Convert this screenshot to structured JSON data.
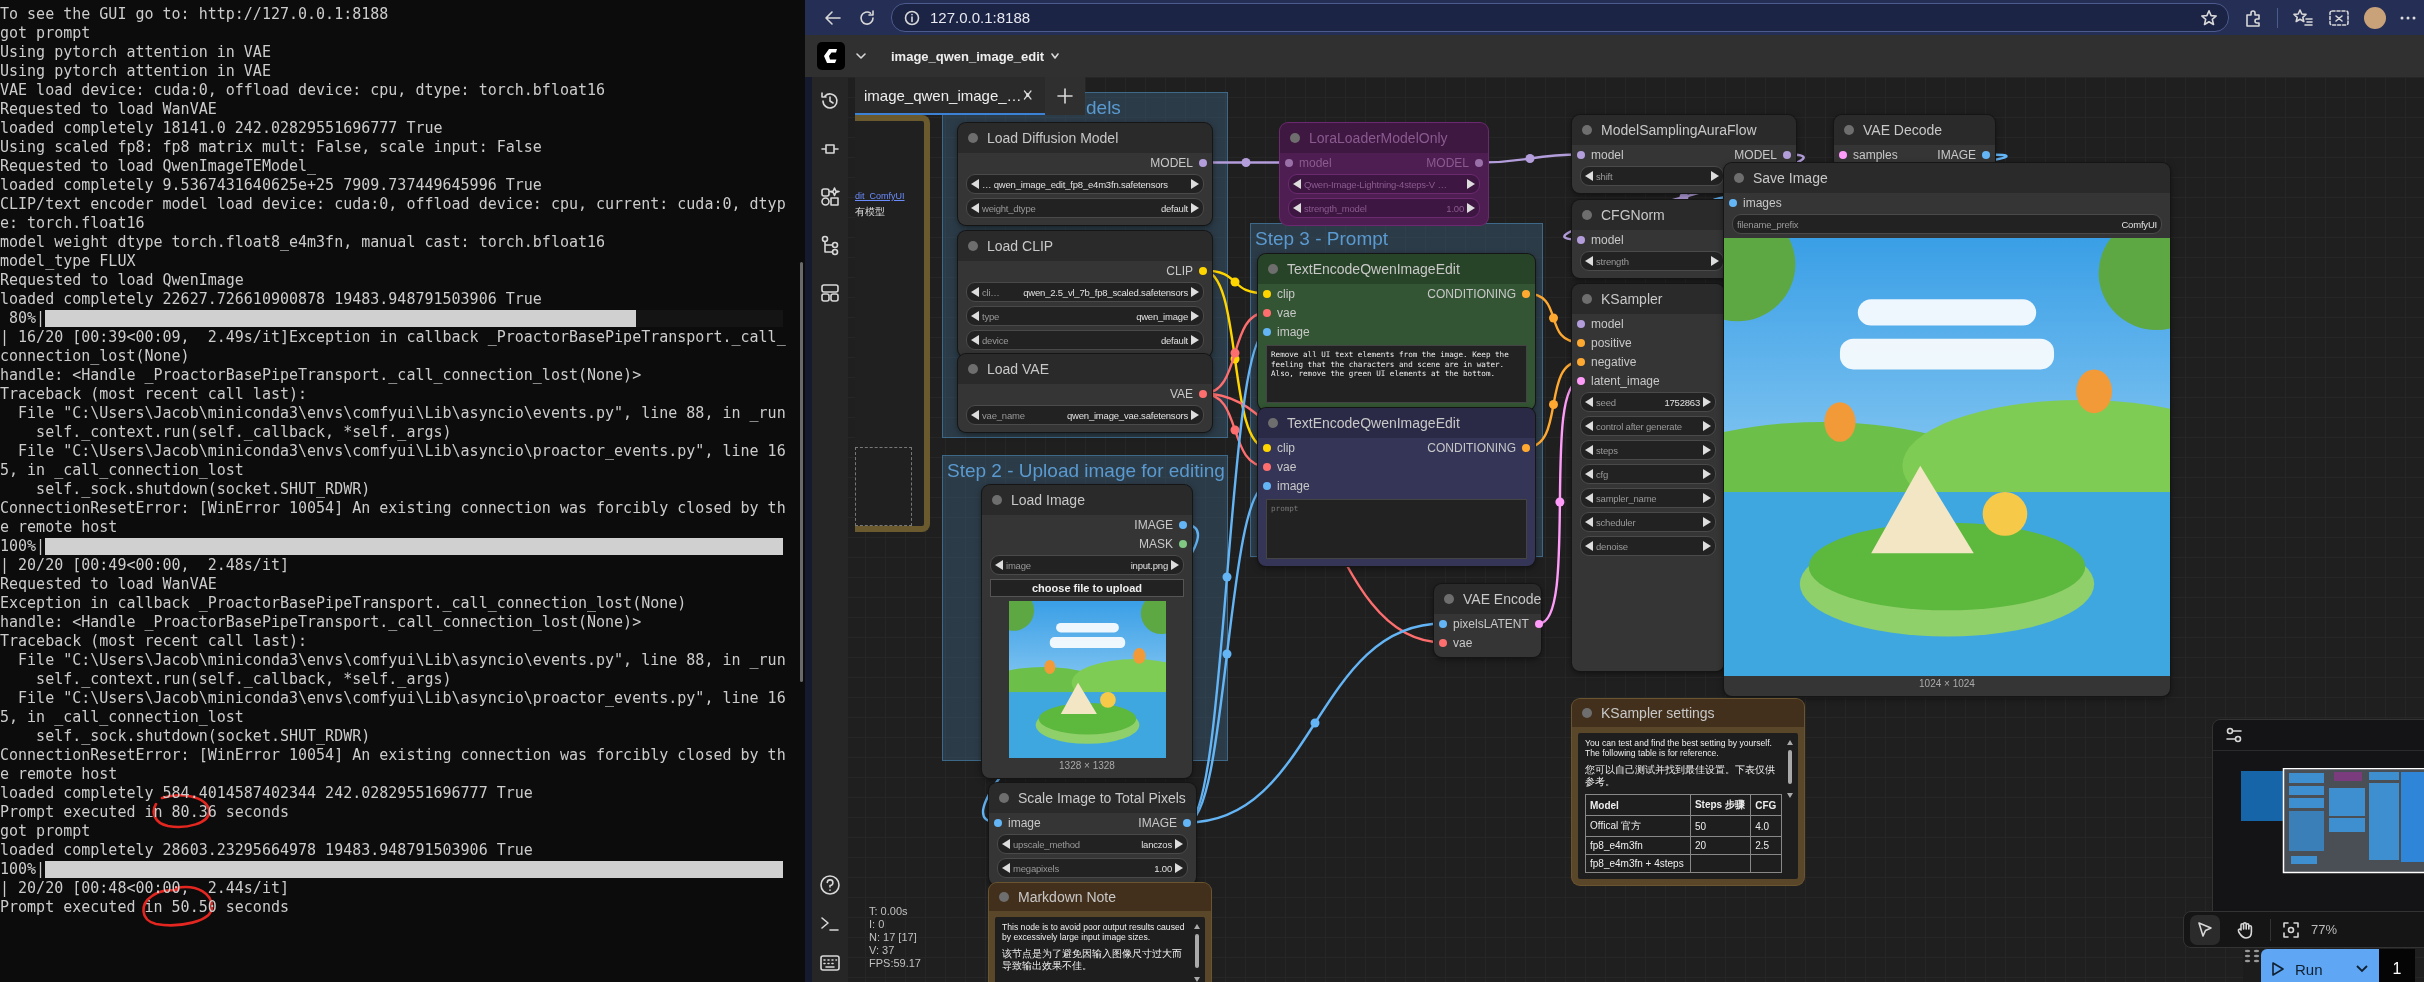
{
  "terminal": {
    "lines": [
      {
        "kind": "text",
        "text": "To see the GUI go to: http://127.0.0.1:8188"
      },
      {
        "kind": "text",
        "text": "got prompt"
      },
      {
        "kind": "text",
        "text": "Using pytorch attention in VAE"
      },
      {
        "kind": "text",
        "text": "Using pytorch attention in VAE"
      },
      {
        "kind": "text",
        "text": "VAE load device: cuda:0, offload device: cpu, dtype: torch.bfloat16"
      },
      {
        "kind": "text",
        "text": "Requested to load WanVAE"
      },
      {
        "kind": "text",
        "text": "loaded completely 18141.0 242.02829551696777 True"
      },
      {
        "kind": "text",
        "text": "Using scaled fp8: fp8 matrix mult: False, scale input: False"
      },
      {
        "kind": "text",
        "text": "Requested to load QwenImageTEModel_"
      },
      {
        "kind": "text",
        "text": "loaded completely 9.5367431640625e+25 7909.737449645996 True"
      },
      {
        "kind": "text",
        "text": "CLIP/text encoder model load device: cuda:0, offload device: cpu, current: cuda:0, dtyp"
      },
      {
        "kind": "text",
        "text": "e: torch.float16"
      },
      {
        "kind": "text",
        "text": "model weight dtype torch.float8_e4m3fn, manual cast: torch.bfloat16"
      },
      {
        "kind": "text",
        "text": "model_type FLUX"
      },
      {
        "kind": "text",
        "text": "Requested to load QwenImage"
      },
      {
        "kind": "text",
        "text": "loaded completely 22627.726610900878 19483.948791503906 True"
      },
      {
        "kind": "progress",
        "text": " 80%|",
        "level": 0.8
      },
      {
        "kind": "text",
        "text": "| 16/20 [00:39<00:09,  2.49s/it]Exception in callback _ProactorBasePipeTransport._call_"
      },
      {
        "kind": "text",
        "text": "connection_lost(None)"
      },
      {
        "kind": "text",
        "text": "handle: <Handle _ProactorBasePipeTransport._call_connection_lost(None)>"
      },
      {
        "kind": "text",
        "text": "Traceback (most recent call last):"
      },
      {
        "kind": "text",
        "text": "  File \"C:\\Users\\Jacob\\miniconda3\\envs\\comfyui\\Lib\\asyncio\\events.py\", line 88, in _run"
      },
      {
        "kind": "text",
        "text": "    self._context.run(self._callback, *self._args)"
      },
      {
        "kind": "text",
        "text": "  File \"C:\\Users\\Jacob\\miniconda3\\envs\\comfyui\\Lib\\asyncio\\proactor_events.py\", line 16"
      },
      {
        "kind": "text",
        "text": "5, in _call_connection_lost"
      },
      {
        "kind": "text",
        "text": "    self._sock.shutdown(socket.SHUT_RDWR)"
      },
      {
        "kind": "text",
        "text": "ConnectionResetError: [WinError 10054] An existing connection was forcibly closed by th"
      },
      {
        "kind": "text",
        "text": "e remote host"
      },
      {
        "kind": "progress",
        "text": "100%|",
        "level": 1
      },
      {
        "kind": "text",
        "text": "| 20/20 [00:49<00:00,  2.48s/it]"
      },
      {
        "kind": "text",
        "text": "Requested to load WanVAE"
      },
      {
        "kind": "text",
        "text": "Exception in callback _ProactorBasePipeTransport._call_connection_lost(None)"
      },
      {
        "kind": "text",
        "text": "handle: <Handle _ProactorBasePipeTransport._call_connection_lost(None)>"
      },
      {
        "kind": "text",
        "text": "Traceback (most recent call last):"
      },
      {
        "kind": "text",
        "text": "  File \"C:\\Users\\Jacob\\miniconda3\\envs\\comfyui\\Lib\\asyncio\\events.py\", line 88, in _run"
      },
      {
        "kind": "text",
        "text": "    self._context.run(self._callback, *self._args)"
      },
      {
        "kind": "text",
        "text": "  File \"C:\\Users\\Jacob\\miniconda3\\envs\\comfyui\\Lib\\asyncio\\proactor_events.py\", line 16"
      },
      {
        "kind": "text",
        "text": "5, in _call_connection_lost"
      },
      {
        "kind": "text",
        "text": "    self._sock.shutdown(socket.SHUT_RDWR)"
      },
      {
        "kind": "text",
        "text": "ConnectionResetError: [WinError 10054] An existing connection was forcibly closed by th"
      },
      {
        "kind": "text",
        "text": "e remote host"
      },
      {
        "kind": "text",
        "text": "loaded completely 584.4014587402344 242.02829551696777 True"
      },
      {
        "kind": "text",
        "text": "Prompt executed in 80.36 seconds"
      },
      {
        "kind": "text",
        "text": "got prompt"
      },
      {
        "kind": "text",
        "text": "loaded completely 28603.23295664978 19483.948791503906 True"
      },
      {
        "kind": "progress",
        "text": "100%|",
        "level": 1
      },
      {
        "kind": "text",
        "text": "| 20/20 [00:48<00:00,  2.44s/it]"
      },
      {
        "kind": "text",
        "text": "Prompt executed in 50.50 seconds"
      }
    ]
  },
  "browser": {
    "url": "127.0.0.1:8188"
  },
  "app": {
    "workflow": "image_qwen_image_edit",
    "tabs": [
      {
        "label": "image_qwen_image_…",
        "selected": true
      }
    ],
    "stats": [
      "T: 0.00s",
      "I: 0",
      "N: 17 [17]",
      "V: 37",
      "FPS:59.17"
    ],
    "canvas_tools": [
      {
        "kind": "select",
        "selected": true
      },
      {
        "kind": "hand",
        "selected": false
      }
    ],
    "zoom": "77%",
    "run": {
      "label": "Run",
      "count": "1"
    }
  },
  "groups": [
    {
      "title": "dels"
    },
    {
      "title": "Step 3 - Prompt"
    },
    {
      "title": "Step 2 - Upload image for editing"
    }
  ],
  "nodes": [
    {
      "kind": "node",
      "title": "Load Diffusion Model",
      "outputs": [
        {
          "name": "MODEL",
          "color": "#b39ddb"
        }
      ],
      "widgets": [
        {
          "kind": "combo",
          "value": "…  qwen_image_edit_fp8_e4m3fn.safetensors"
        },
        {
          "kind": "combo",
          "label": "weight_dtype",
          "value": "default"
        }
      ]
    },
    {
      "kind": "node",
      "title": "Load CLIP",
      "outputs": [
        {
          "name": "CLIP",
          "color": "#ffd500"
        }
      ],
      "widgets": [
        {
          "kind": "combo",
          "label": "cli…",
          "value": "qwen_2.5_vl_7b_fp8_scaled.safetensors"
        },
        {
          "kind": "combo",
          "label": "type",
          "value": "qwen_image"
        },
        {
          "kind": "combo",
          "label": "device",
          "value": "default"
        }
      ]
    },
    {
      "kind": "node",
      "title": "Load VAE",
      "outputs": [
        {
          "name": "VAE",
          "color": "#ff6e6e"
        }
      ],
      "widgets": [
        {
          "kind": "combo",
          "label": "vae_name",
          "value": "qwen_image_vae.safetensors"
        }
      ]
    },
    {
      "kind": "bypassed",
      "title": "LoraLoaderModelOnly",
      "inputs": [
        {
          "name": "model"
        }
      ],
      "outputs": [
        {
          "name": "MODEL"
        }
      ],
      "widgets": [
        {
          "kind": "combo",
          "value": "Qwen-Image-Lightning-4steps-V …"
        },
        {
          "kind": "number",
          "label": "strength_model",
          "value": "1.00"
        }
      ]
    },
    {
      "kind": "node",
      "title": "TextEncodeQwenImageEdit",
      "color": "#335533",
      "inputs": [
        {
          "name": "clip",
          "color": "#ffd500"
        },
        {
          "name": "vae",
          "color": "#ff6e6e"
        },
        {
          "name": "image",
          "color": "#64b5f6"
        }
      ],
      "outputs": [
        {
          "name": "CONDITIONING",
          "color": "#ffa931"
        }
      ],
      "widgets": [
        {
          "kind": "textarea",
          "value": "Remove all UI text elements from the image. Keep the feeling that the characters and scene are in water. Also, remove the green UI elements at the bottom."
        }
      ]
    },
    {
      "kind": "node",
      "title": "TextEncodeQwenImageEdit",
      "color": "#353558",
      "inputs": [
        {
          "name": "clip",
          "color": "#ffd500"
        },
        {
          "name": "vae",
          "color": "#ff6e6e"
        },
        {
          "name": "image",
          "color": "#64b5f6"
        }
      ],
      "outputs": [
        {
          "name": "CONDITIONING",
          "color": "#ffa931"
        }
      ],
      "widgets": [
        {
          "kind": "textarea",
          "placeholder": "prompt"
        }
      ]
    },
    {
      "kind": "node",
      "title": "Load Image",
      "outputs": [
        {
          "name": "IMAGE",
          "color": "#64b5f6"
        },
        {
          "name": "MASK",
          "color": "#81c784"
        }
      ],
      "widgets": [
        {
          "kind": "combo",
          "label": "image",
          "value": "input.png"
        },
        {
          "kind": "button",
          "label": "choose file to upload"
        },
        {
          "kind": "image",
          "caption": "1328 × 1328"
        }
      ]
    },
    {
      "kind": "node",
      "title": "Scale Image to Total Pixels",
      "inputs": [
        {
          "name": "image",
          "color": "#64b5f6"
        }
      ],
      "outputs": [
        {
          "name": "IMAGE",
          "color": "#64b5f6"
        }
      ],
      "widgets": [
        {
          "kind": "combo",
          "label": "upscale_method",
          "value": "lanczos"
        },
        {
          "kind": "number",
          "label": "megapixels",
          "value": "1.00"
        }
      ]
    },
    {
      "kind": "note",
      "title": "Markdown Note",
      "color": "#5a4628",
      "paragraphs": [
        "This node is to avoid poor output results caused by excessively large input image sizes.",
        "该节点是为了避免因输入图像尺寸过大而导致输出效果不佳。"
      ]
    },
    {
      "kind": "node",
      "title": "VAE Encode",
      "inputs": [
        {
          "name": "pixels",
          "color": "#64b5f6"
        },
        {
          "name": "vae",
          "color": "#ff6e6e"
        }
      ],
      "outputs": [
        {
          "name": "LATENT",
          "color": "#ff9cf9"
        }
      ]
    },
    {
      "kind": "node",
      "title": "ModelSamplingAuraFlow",
      "inputs": [
        {
          "name": "model",
          "color": "#b39ddb"
        }
      ],
      "outputs": [
        {
          "name": "MODEL",
          "color": "#b39ddb"
        }
      ],
      "widgets": [
        {
          "kind": "number",
          "label": "shift"
        }
      ]
    },
    {
      "kind": "node",
      "title": "VAE Decode",
      "inputs": [
        {
          "name": "samples",
          "color": "#ff9cf9"
        }
      ],
      "outputs": [
        {
          "name": "IMAGE",
          "color": "#64b5f6"
        }
      ]
    },
    {
      "kind": "node",
      "title": "CFGNorm",
      "inputs": [
        {
          "name": "model",
          "color": "#b39ddb"
        }
      ],
      "widgets": [
        {
          "kind": "number",
          "label": "strength"
        }
      ]
    },
    {
      "kind": "node",
      "title": "KSampler",
      "inputs": [
        {
          "name": "model",
          "color": "#b39ddb"
        },
        {
          "name": "positive",
          "color": "#ffa931"
        },
        {
          "name": "negative",
          "color": "#ffa931"
        },
        {
          "name": "latent_image",
          "color": "#ff9cf9"
        }
      ],
      "widgets": [
        {
          "kind": "number",
          "label": "seed",
          "value": "1752863"
        },
        {
          "kind": "combo",
          "label": "control after generate"
        },
        {
          "kind": "number",
          "label": "steps"
        },
        {
          "kind": "number",
          "label": "cfg"
        },
        {
          "kind": "combo",
          "label": "sampler_name"
        },
        {
          "kind": "combo",
          "label": "scheduler"
        },
        {
          "kind": "number",
          "label": "denoise"
        }
      ]
    },
    {
      "kind": "node",
      "title": "Save Image",
      "inputs": [
        {
          "name": "images",
          "color": "#64b5f6"
        }
      ],
      "widgets": [
        {
          "kind": "text",
          "label": "filename_prefix",
          "value": "ComfyUI"
        },
        {
          "kind": "image",
          "caption": "1024 × 1024"
        }
      ]
    },
    {
      "kind": "note",
      "title": "KSampler settings",
      "color": "#5a4628",
      "paragraphs": [
        "You can test and find the best setting by yourself. The following table is for reference.",
        "您可以自己测试并找到最佳设置。下表仅供参考。"
      ],
      "table": {
        "columns": [
          "Model",
          "Steps 步骤",
          "CFG"
        ],
        "rows": [
          [
            "Offical  官方",
            "50",
            "4.0"
          ],
          [
            "fp8_e4m3fn",
            "20",
            "2.5"
          ],
          [
            "fp8_e4m3fn + 4steps"
          ]
        ]
      }
    },
    {
      "kind": "partial",
      "texts": [
        {
          "kind": "link",
          "text": "dit_ComfyUI"
        },
        {
          "kind": "text",
          "text": "有模型"
        }
      ]
    }
  ]
}
